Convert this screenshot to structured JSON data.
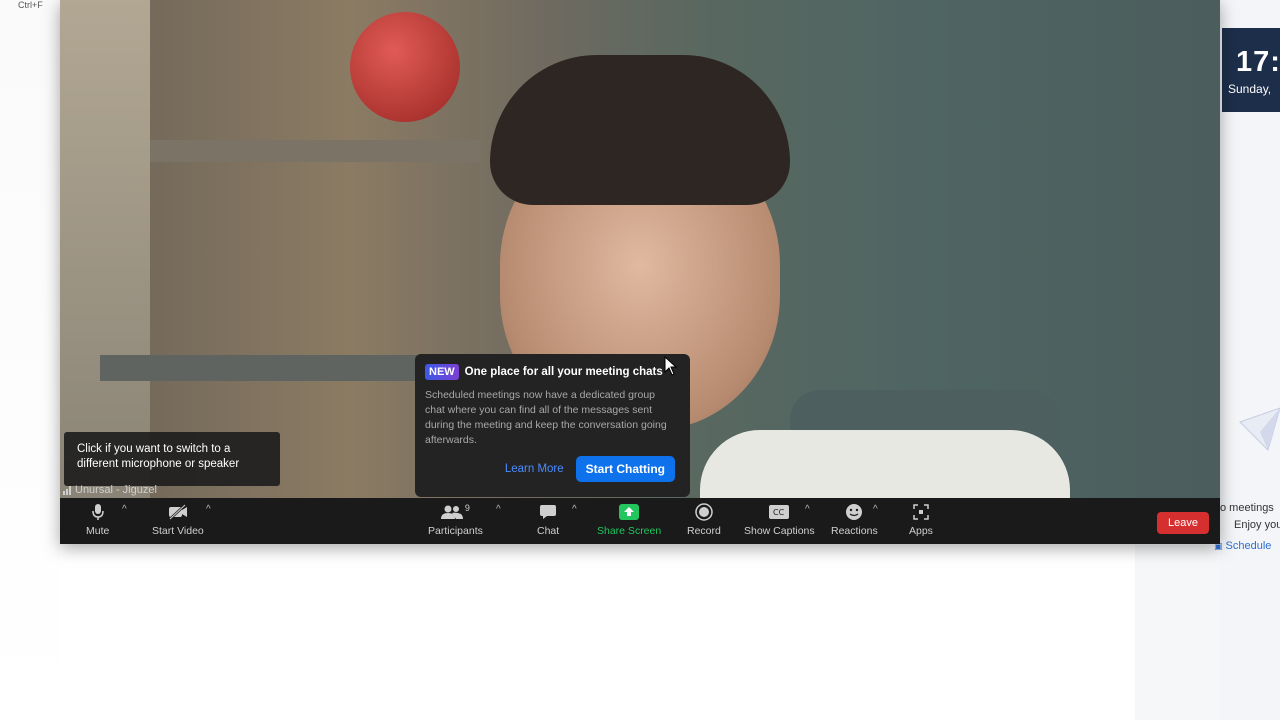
{
  "background": {
    "shortcut_text": "Ctrl+F"
  },
  "right_panel": {
    "clock_time": "17:",
    "clock_date": "Sunday, ",
    "text_line1": "o meetings",
    "text_line2": "Enjoy you",
    "schedule_link": "Schedule"
  },
  "meeting": {
    "participant_name": "Unursal - Jiguzel",
    "mic_tooltip_line1": "Click if you want to switch to a",
    "mic_tooltip_line2": "different microphone or speaker"
  },
  "popup": {
    "badge": "NEW",
    "title": "One place for all your meeting chats",
    "body": "Scheduled meetings now have a dedicated group chat where you can find all of the messages sent during the meeting and keep the conversation going afterwards.",
    "learn_more": "Learn More",
    "start_chatting": "Start Chatting"
  },
  "toolbar": {
    "mute": "Mute",
    "start_video": "Start Video",
    "participants": "Participants",
    "participants_count": "9",
    "chat": "Chat",
    "share_screen": "Share Screen",
    "record": "Record",
    "show_captions": "Show Captions",
    "reactions": "Reactions",
    "apps": "Apps",
    "leave": "Leave"
  },
  "colors": {
    "share_green": "#22c55e",
    "leave_red": "#d62f2f",
    "primary_blue": "#0e72ed"
  }
}
